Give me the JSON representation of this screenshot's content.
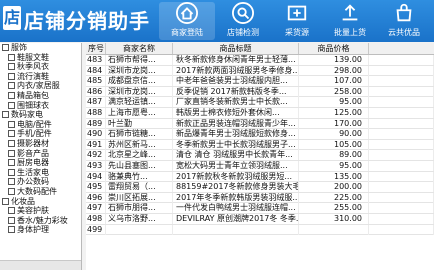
{
  "app": {
    "title": "店铺分销助手"
  },
  "toolbar": [
    {
      "label": "商家登陆",
      "icon": "home-icon"
    },
    {
      "label": "店铺检测",
      "icon": "shop-check-icon"
    },
    {
      "label": "采货源",
      "icon": "source-icon"
    },
    {
      "label": "批量上货",
      "icon": "upload-icon"
    },
    {
      "label": "云共优品",
      "icon": "cloud-bag-icon"
    }
  ],
  "tree": [
    {
      "label": "服饰",
      "level": 0
    },
    {
      "label": "鞋服文鞋",
      "level": 1
    },
    {
      "label": "秋季风衣",
      "level": 1
    },
    {
      "label": "流行演鞋",
      "level": 1
    },
    {
      "label": "内衣/家居服",
      "level": 1
    },
    {
      "label": "精品箱包",
      "level": 1
    },
    {
      "label": "围钿球衣",
      "level": 1
    },
    {
      "label": "数码家电",
      "level": 0
    },
    {
      "label": "电脑/配件",
      "level": 1
    },
    {
      "label": "手机/配件",
      "level": 1
    },
    {
      "label": "摄影器材",
      "level": 1
    },
    {
      "label": "影音产品",
      "level": 1
    },
    {
      "label": "厨房电器",
      "level": 1
    },
    {
      "label": "生活家电",
      "level": 1
    },
    {
      "label": "办公数码",
      "level": 1
    },
    {
      "label": "大数码配件",
      "level": 1
    },
    {
      "label": "化妆品",
      "level": 0
    },
    {
      "label": "美容护肤",
      "level": 1
    },
    {
      "label": "香水/魅力彩妆",
      "level": 1
    },
    {
      "label": "身体护理",
      "level": 1
    }
  ],
  "grid": {
    "columns": [
      "序号",
      "商家名称",
      "商品标题",
      "商品价格"
    ],
    "rows": [
      {
        "no": "483",
        "shop": "石狮市帮得...",
        "title": "秋冬新款修身休闲青年男士轻薄...",
        "price": "139.00"
      },
      {
        "no": "484",
        "shop": "深圳市龙岗...",
        "title": "2017新款两面羽绒服男冬季修身...",
        "price": "298.00"
      },
      {
        "no": "485",
        "shop": "成都盘京信...",
        "title": "中老年爸爸装男士羽绒服内胆...",
        "price": "107.00"
      },
      {
        "no": "486",
        "shop": "深圳市龙岗...",
        "title": "反季促销 2017新款韩版冬季...",
        "price": "258.00"
      },
      {
        "no": "487",
        "shop": "满京轻运镇...",
        "title": "厂家直销冬装新款男士中长款...",
        "price": "95.00"
      },
      {
        "no": "488",
        "shop": "上海市愿粤...",
        "title": "韩版男士棉衣修短外套休闲...",
        "price": "125.00"
      },
      {
        "no": "489",
        "shop": "叶兰勤",
        "title": "新款正品男装连帽羽绒服青少年...",
        "price": "170.00"
      },
      {
        "no": "490",
        "shop": "石狮市链糖...",
        "title": "新品爆青年男士羽绒服短款修身...",
        "price": "90.00"
      },
      {
        "no": "491",
        "shop": "苏州区新马...",
        "title": "冬季新款男士中长款羽绒服男子...",
        "price": "105.00"
      },
      {
        "no": "492",
        "shop": "北京星之峰...",
        "title": "清仓 清仓 羽绒服男中长款青年...",
        "price": "89.00"
      },
      {
        "no": "493",
        "shop": "先山县塞图...",
        "title": "宽松大码男士青年立领羽绒服...",
        "price": "95.00"
      },
      {
        "no": "494",
        "shop": "骆兼典竹...",
        "title": "2017新款秋冬新款羽绒服男短...",
        "price": "135.00"
      },
      {
        "no": "495",
        "shop": "雷翔贸易（...",
        "title": "88159#2017冬新款修身男装大毛...",
        "price": "200.00"
      },
      {
        "no": "496",
        "shop": "崇川区拓展...",
        "title": "2017年冬季新款韩版男装羽绒服...",
        "price": "225.00"
      },
      {
        "no": "497",
        "shop": "石狮市朋得...",
        "title": "一件代发白鸭绒男士羽绒服连帽...",
        "price": "255.00"
      },
      {
        "no": "498",
        "shop": "义乌市洛野...",
        "title": "DEVILRAY 原创潮牌2017冬 冬季...",
        "price": "310.00"
      },
      {
        "no": "499",
        "shop": "",
        "title": "",
        "price": ""
      }
    ]
  }
}
